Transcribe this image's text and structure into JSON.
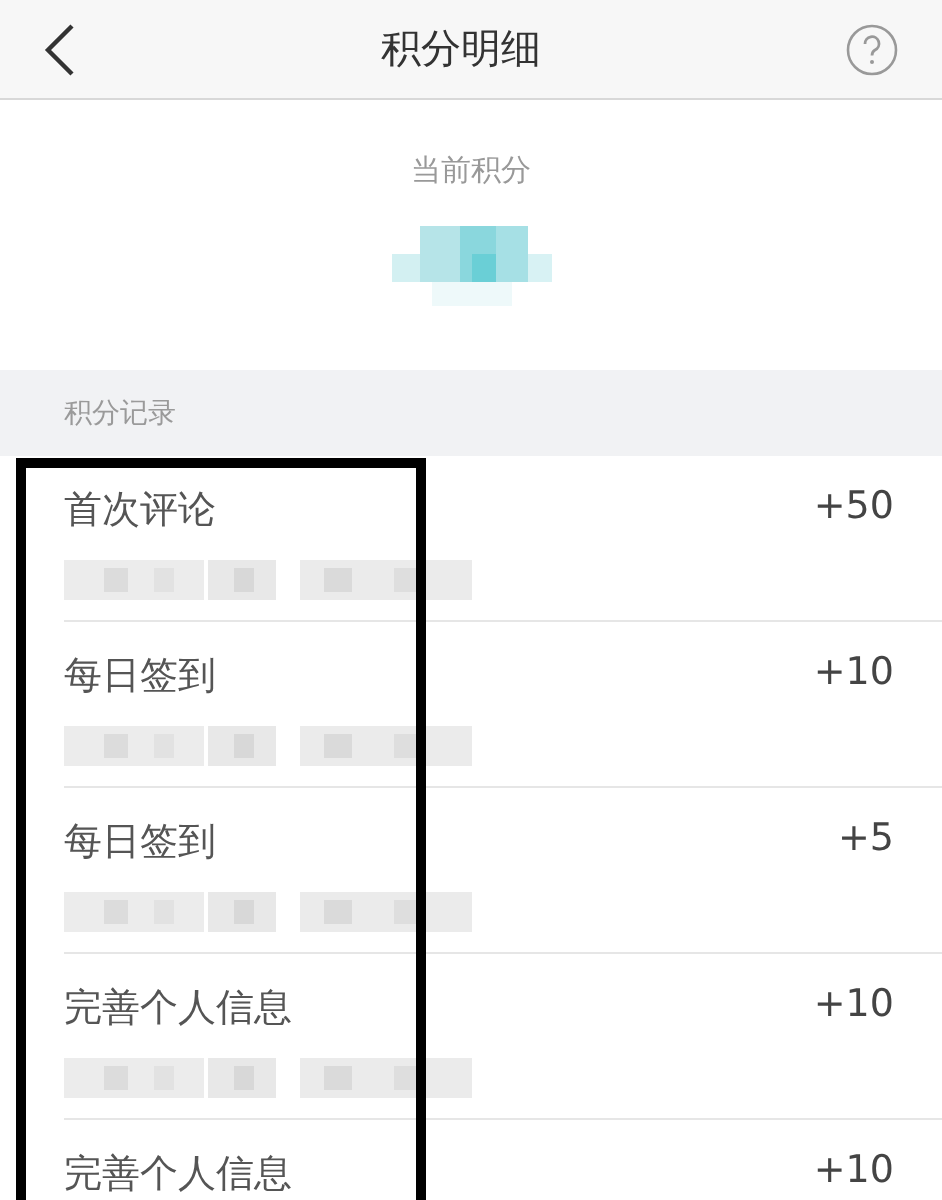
{
  "header": {
    "title": "积分明细"
  },
  "balance": {
    "label": "当前积分",
    "redacted": true
  },
  "records": {
    "title": "积分记录",
    "items": [
      {
        "name": "首次评论",
        "points": "+50"
      },
      {
        "name": "每日签到",
        "points": "+10"
      },
      {
        "name": "每日签到",
        "points": "+5"
      },
      {
        "name": "完善个人信息",
        "points": "+10"
      },
      {
        "name": "完善个人信息",
        "points": "+10"
      }
    ]
  },
  "annotation": {
    "highlight": true
  }
}
